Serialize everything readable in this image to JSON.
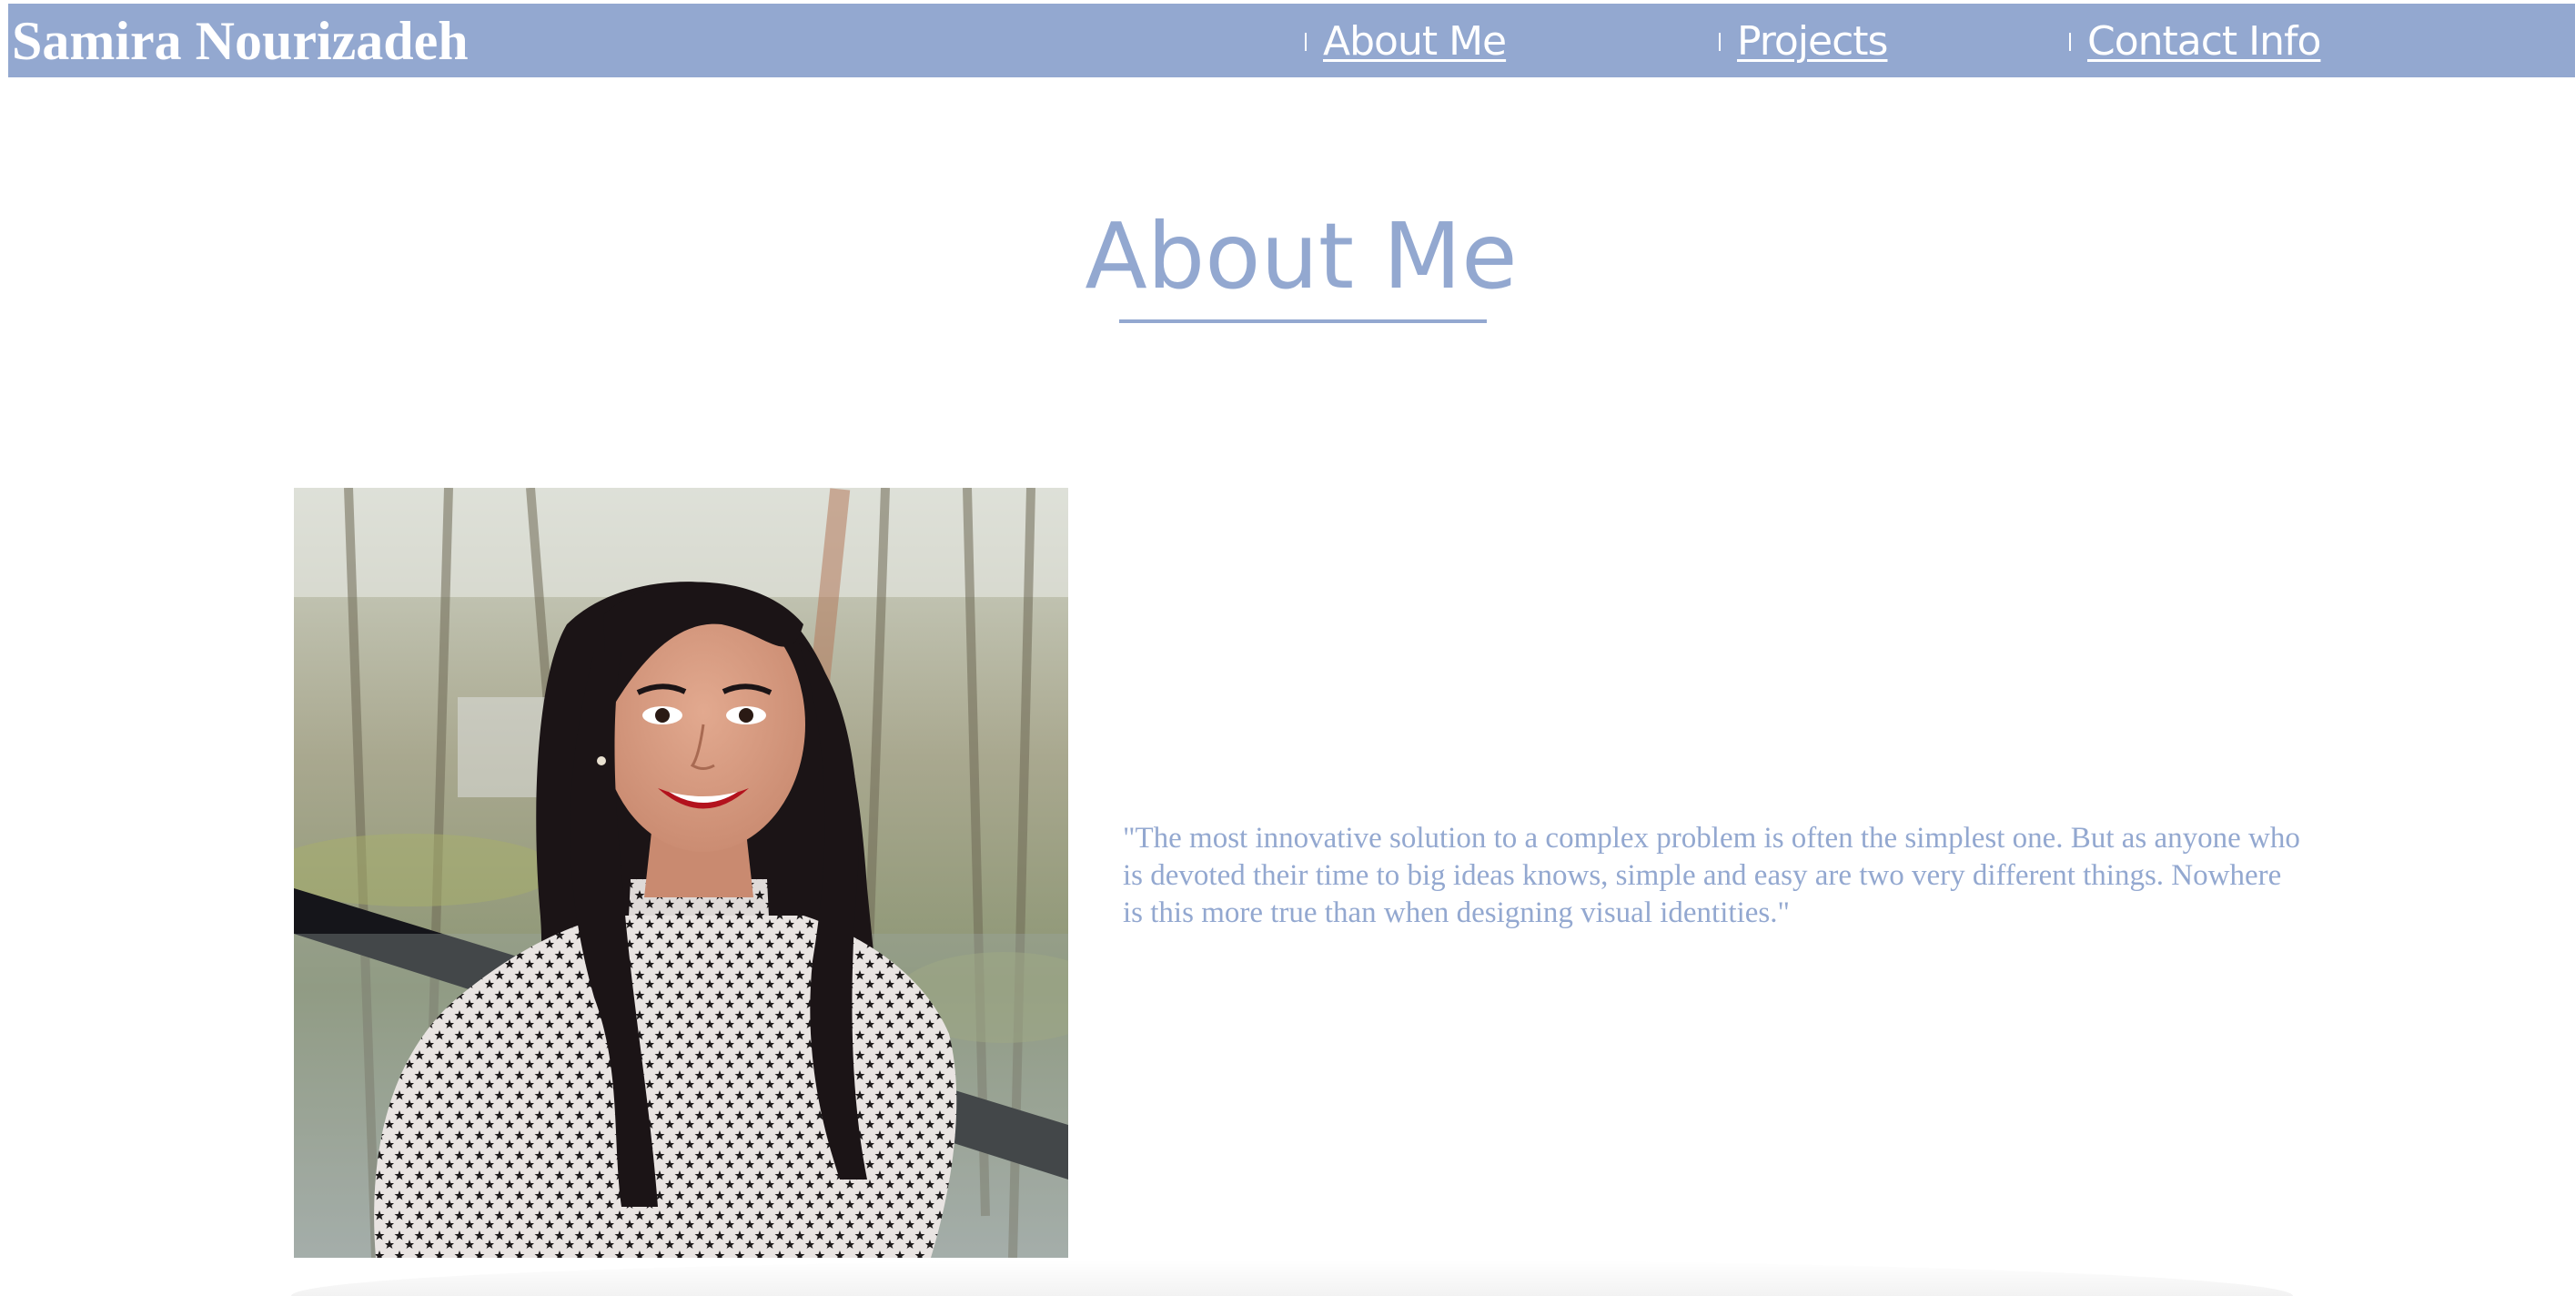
{
  "header": {
    "brand": "Samira Nourizadeh",
    "nav": [
      {
        "label": "About Me"
      },
      {
        "label": "Projects"
      },
      {
        "label": "Contact Info"
      }
    ]
  },
  "main": {
    "title": "About Me",
    "quote": "\"The most innovative solution to a complex problem is often the simplest one. But as anyone who is devoted their time to big ideas knows, simple and easy are two very different things. Nowhere is this more true than when designing visual identities.\""
  },
  "colors": {
    "accent": "#93a8d0",
    "background": "#ffffff",
    "nav_text": "#ffffff"
  }
}
